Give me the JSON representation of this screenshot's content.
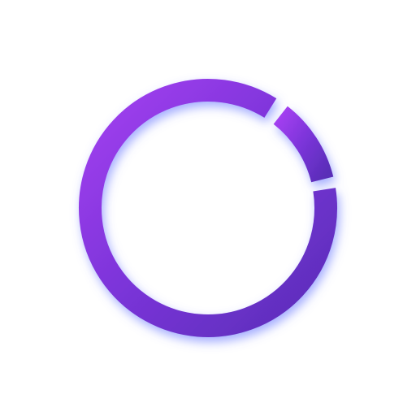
{
  "logo": {
    "icon": "segmented-ring-logo-icon",
    "colors": {
      "background": "#ffffff",
      "gradient_start": "#a33ff0",
      "gradient_mid": "#7a34d8",
      "gradient_end": "#5a2db8",
      "glow": "#5b6cff"
    }
  }
}
